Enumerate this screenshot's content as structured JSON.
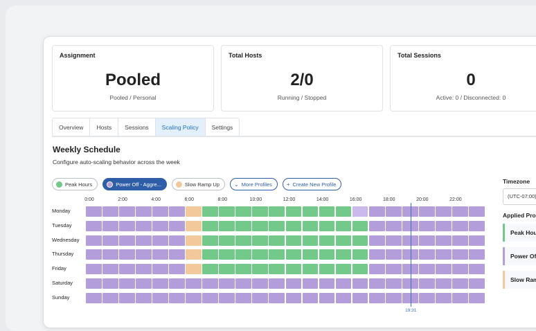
{
  "cards": [
    {
      "title": "Assignment",
      "value": "Pooled",
      "sub": "Pooled / Personal"
    },
    {
      "title": "Total Hosts",
      "value": "2/0",
      "sub": "Running / Stopped"
    },
    {
      "title": "Total Sessions",
      "value": "0",
      "sub": "Active: 0 / Disconnected: 0"
    }
  ],
  "tabs": [
    "Overview",
    "Hosts",
    "Sessions",
    "Scaling Policy",
    "Settings"
  ],
  "active_tab": "Scaling Policy",
  "schedule": {
    "title": "Weekly Schedule",
    "subtitle": "Configure auto-scaling behavior across the week"
  },
  "chips": {
    "peak": "Peak Hours",
    "poweroff": "Power Off - Aggre...",
    "rampup": "Slow Ramp Up",
    "more": "More Profiles",
    "create": "Create New Profile"
  },
  "hour_labels": [
    "0:00",
    "2:00",
    "4:00",
    "6:00",
    "8:00",
    "10:00",
    "12:00",
    "14:00",
    "16:00",
    "18:00",
    "20:00",
    "22:00"
  ],
  "days": [
    "Monday",
    "Tuesday",
    "Wednesday",
    "Thursday",
    "Friday",
    "Saturday",
    "Sunday"
  ],
  "profile_colors": {
    "off": "#b39ddb",
    "ramp": "#f2c99b",
    "peak": "#72c98a",
    "off_light": "#cbb9ec"
  },
  "day_segments": [
    {
      "off": [
        [
          0,
          6
        ],
        [
          16,
          24
        ]
      ],
      "ramp": [
        [
          6,
          7
        ]
      ],
      "peak": [
        [
          7,
          16
        ]
      ],
      "off_light": [
        [
          16,
          17
        ]
      ]
    },
    {
      "off": [
        [
          0,
          6
        ],
        [
          17,
          24
        ]
      ],
      "ramp": [
        [
          6,
          7
        ]
      ],
      "peak": [
        [
          7,
          17
        ]
      ]
    },
    {
      "off": [
        [
          0,
          6
        ],
        [
          17,
          24
        ]
      ],
      "ramp": [
        [
          6,
          7
        ]
      ],
      "peak": [
        [
          7,
          17
        ]
      ]
    },
    {
      "off": [
        [
          0,
          6
        ],
        [
          17,
          24
        ]
      ],
      "ramp": [
        [
          6,
          7
        ]
      ],
      "peak": [
        [
          7,
          17
        ]
      ]
    },
    {
      "off": [
        [
          0,
          6
        ],
        [
          17,
          24
        ]
      ],
      "ramp": [
        [
          6,
          7
        ]
      ],
      "peak": [
        [
          7,
          17
        ]
      ]
    },
    {
      "off": [
        [
          0,
          24
        ]
      ]
    },
    {
      "off": [
        [
          0,
          24
        ]
      ]
    }
  ],
  "current_time": "19:31",
  "current_hour": 19.52,
  "sidebar": {
    "timezone_label": "Timezone",
    "timezone_value": "(UTC-07:00)",
    "applied_label": "Applied Profi",
    "profiles": [
      {
        "name": "Peak Hour",
        "color": "#72c98a"
      },
      {
        "name": "Power Off",
        "color": "#b39ddb"
      },
      {
        "name": "Slow Ramp",
        "color": "#f2c99b"
      }
    ]
  }
}
